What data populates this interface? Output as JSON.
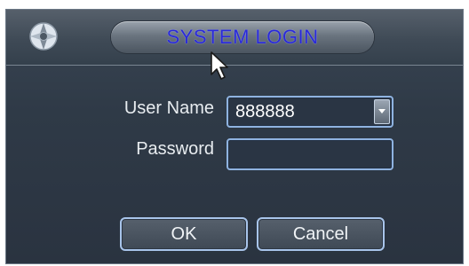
{
  "dialog": {
    "title": "SYSTEM LOGIN",
    "title_color": "#2a2ad8",
    "app_icon": "dvr-logo-icon"
  },
  "form": {
    "username_label": "User Name",
    "username_value": "888888",
    "password_label": "Password",
    "password_value": ""
  },
  "buttons": {
    "ok_label": "OK",
    "cancel_label": "Cancel"
  }
}
